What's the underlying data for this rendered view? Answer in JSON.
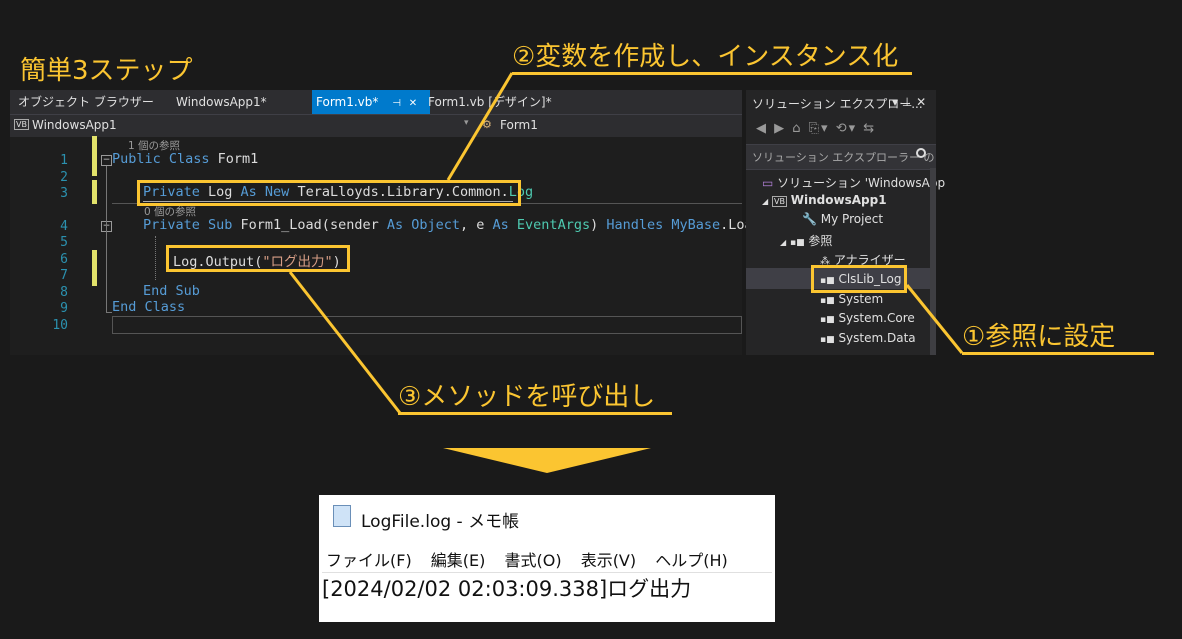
{
  "title": "簡単3ステップ",
  "annotations": {
    "step1": "①参照に設定",
    "step2": "②変数を作成し、インスタンス化",
    "step3": "③メソッドを呼び出し"
  },
  "ide": {
    "tabs": {
      "object_browser": "オブジェクト ブラウザー",
      "windowsapp": "WindowsApp1*",
      "form1_vb": "Form1.vb*",
      "pin": "⊣",
      "close": "✕",
      "form1_design": "Form1.vb [デザイン]*"
    },
    "nav": {
      "project": "WindowsApp1",
      "member": "Form1",
      "vb_badge": "VB"
    },
    "ref_count_1": "1 個の参照",
    "ref_count_0": "0 個の参照",
    "line_numbers": [
      "1",
      "2",
      "3",
      "4",
      "5",
      "6",
      "7",
      "8",
      "9",
      "10"
    ],
    "code": {
      "l1_kw": "Public Class",
      "l1_name": " Form1",
      "l3_kw1": "Private",
      "l3_name": " Log ",
      "l3_kw2": "As New",
      "l3_ns": " TeraLloyds.Library.Common.",
      "l3_type": "Log",
      "l4_kw1": "Private Sub",
      "l4_name": " Form1_Load(sender ",
      "l4_kw2": "As",
      "l4_ty1": " Object",
      "l4_p2": ", e ",
      "l4_kw3": "As",
      "l4_ty2": " EventArgs",
      "l4_p3": ") ",
      "l4_kw4": "Handles MyBase",
      "l4_end": ".Load",
      "l6_call": "Log.Output(",
      "l6_str": "\"ログ出力\"",
      "l6_close": ")",
      "l8": "End Sub",
      "l9": "End Class"
    }
  },
  "solution": {
    "header": "ソリューション エクスプロー...",
    "header_icons": "▾ 𝟒 ✕",
    "toolbar": "◀ ▶ ⌂ ⎘▾ ⟲▾ ⇆",
    "search_placeholder": "ソリューション エクスプローラー の",
    "search_icon": "🔍",
    "items": [
      {
        "label": "ソリューション 'WindowsApp",
        "arrow": "",
        "icon": "▭"
      },
      {
        "label": "WindowsApp1",
        "arrow": "◢",
        "icon": "VB"
      },
      {
        "label": "My Project",
        "arrow": "",
        "icon": "🔧"
      },
      {
        "label": "参照",
        "arrow": "◢",
        "icon": "▪■"
      },
      {
        "label": "アナライザー",
        "arrow": "",
        "icon": "⁂"
      },
      {
        "label": "ClsLib_Log",
        "arrow": "",
        "icon": "▪■"
      },
      {
        "label": "System",
        "arrow": "",
        "icon": "▪■"
      },
      {
        "label": "System.Core",
        "arrow": "",
        "icon": "▪■"
      },
      {
        "label": "System.Data",
        "arrow": "",
        "icon": "▪■"
      }
    ]
  },
  "notepad": {
    "title": "LogFile.log - メモ帳",
    "menu": [
      "ファイル(F)",
      "編集(E)",
      "書式(O)",
      "表示(V)",
      "ヘルプ(H)"
    ],
    "content": "[2024/02/02 02:03:09.338]ログ出力"
  },
  "colors": {
    "accent": "#fbc531",
    "tab_active": "#007acc"
  }
}
